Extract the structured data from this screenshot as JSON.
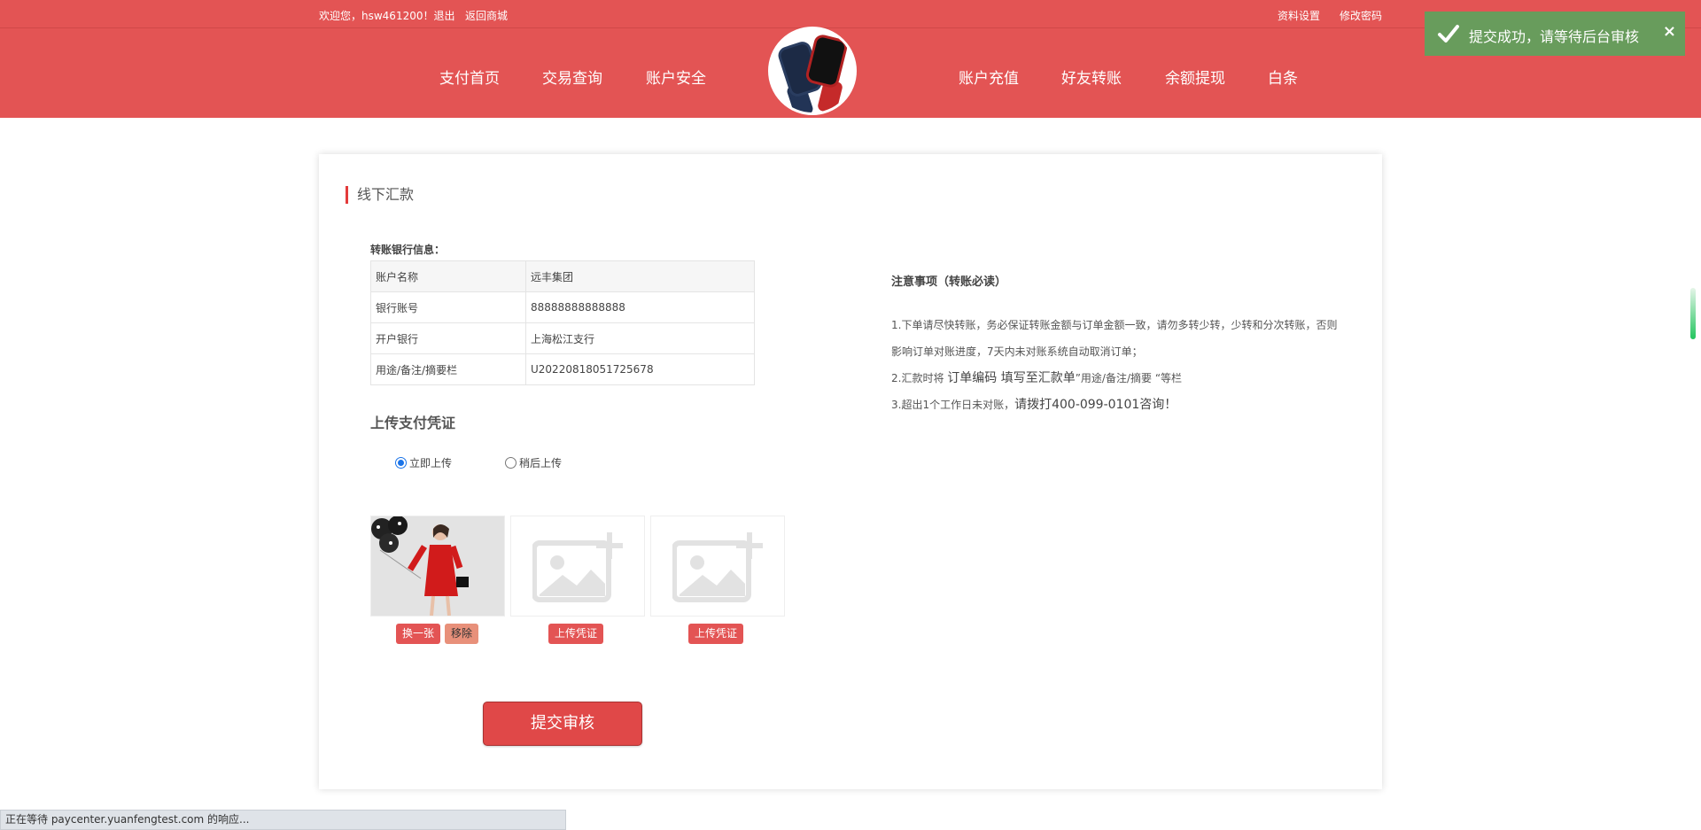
{
  "topbar": {
    "welcome": "欢迎您，hsw461200！退出",
    "back_to_mall": "返回商城",
    "profile_settings": "资料设置",
    "change_password": "修改密码"
  },
  "nav": {
    "left": [
      "支付首页",
      "交易查询",
      "账户安全"
    ],
    "right": [
      "账户充值",
      "好友转账",
      "余额提现",
      "白条"
    ],
    "accent": "#e35454"
  },
  "card": {
    "title": "线下汇款",
    "bank_info_label": "转账银行信息：",
    "bank_table": [
      {
        "key": "账户名称",
        "value": "远丰集团"
      },
      {
        "key": "银行账号",
        "value": "88888888888888"
      },
      {
        "key": "开户银行",
        "value": "上海松江支行"
      },
      {
        "key": "用途/备注/摘要栏",
        "value": "U20220818051725678"
      }
    ],
    "upload_title": "上传支付凭证",
    "radio_now": "立即上传",
    "radio_later": "稍后上传",
    "radio_selected": "立即上传",
    "btn_replace": "换一张",
    "btn_remove": "移除",
    "btn_upload": "上传凭证",
    "submit": "提交审核"
  },
  "notes": {
    "title": "注意事项（转账必读）",
    "line1": "1.下单请尽快转账，务必保证转账金额与订单金额一致，请勿多转少转，少转和分次转账，否则影响订单对账进度，7天内未对账系统自动取消订单；",
    "line2a": "2.汇款时将 ",
    "line2b": "订单编码 填写至汇款单",
    "line2c": "”用途/备注/摘要 “等栏",
    "line3a": "3.超出1个工作日未对账，",
    "line3b": "请拨打400-099-0101咨询！"
  },
  "toast": {
    "message": "提交成功，请等待后台审核",
    "close": "×",
    "color": "#689c5c"
  },
  "status_bar": "正在等待 paycenter.yuanfengtest.com 的响应..."
}
